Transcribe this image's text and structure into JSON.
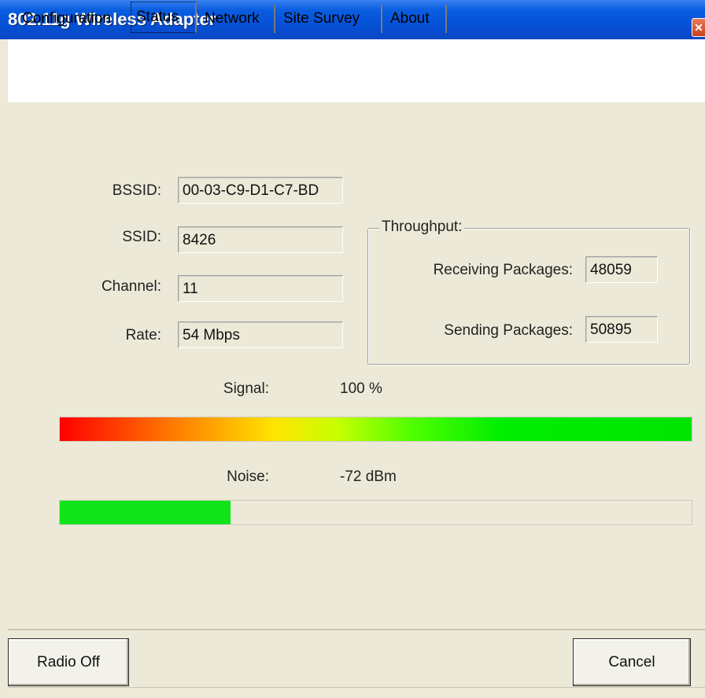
{
  "window": {
    "title": "802.11g Wireless Adapter",
    "close_glyph": "✕"
  },
  "tabs": [
    {
      "label": "Configuration",
      "active": false
    },
    {
      "label": "Status",
      "active": true
    },
    {
      "label": "Network",
      "active": false
    },
    {
      "label": "Site Survey",
      "active": false
    },
    {
      "label": "About",
      "active": false
    }
  ],
  "status": {
    "bssid_label": "BSSID:",
    "bssid_value": "00-03-C9-D1-C7-BD",
    "ssid_label": "SSID:",
    "ssid_value": "8426",
    "channel_label": "Channel:",
    "channel_value": "11",
    "rate_label": "Rate:",
    "rate_value": "54 Mbps"
  },
  "throughput": {
    "title": "Throughput:",
    "receiving_label": "Receiving Packages:",
    "receiving_value": "48059",
    "sending_label": "Sending Packages:",
    "sending_value": "50895"
  },
  "signal": {
    "label": "Signal:",
    "value_text": "100 %",
    "level_percent": 100
  },
  "noise": {
    "label": "Noise:",
    "value_text": "-72 dBm",
    "level_percent": 27
  },
  "buttons": {
    "radio_off": "Radio Off",
    "cancel": "Cancel"
  },
  "colors": {
    "title_bar": "#0a5ee0",
    "window_bg": "#ece9d8",
    "noise_bar": "#11e41a"
  }
}
